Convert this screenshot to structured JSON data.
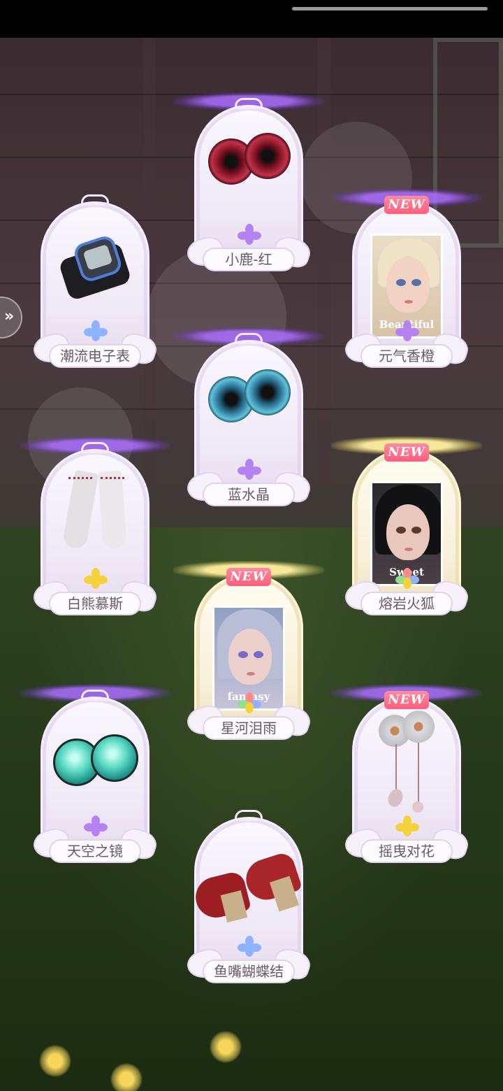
{
  "items": [
    {
      "name": "小鹿-红",
      "new": false,
      "gem": "purple",
      "glow": "purple",
      "kind": "eyes-red"
    },
    {
      "name": "潮流电子表",
      "new": false,
      "gem": "blue",
      "glow": "none",
      "kind": "watch"
    },
    {
      "name": "元气香橙",
      "new": true,
      "gem": "purple",
      "glow": "purple",
      "kind": "portrait",
      "portrait_text": "Beautiful"
    },
    {
      "name": "蓝水晶",
      "new": false,
      "gem": "purple",
      "glow": "purple",
      "kind": "eyes-blue"
    },
    {
      "name": "白熊慕斯",
      "new": false,
      "gem": "gold",
      "glow": "purple",
      "kind": "socks"
    },
    {
      "name": "熔岩火狐",
      "new": true,
      "gem": "rainbow",
      "glow": "gold",
      "kind": "portrait",
      "portrait_text": "Sweet"
    },
    {
      "name": "星河泪雨",
      "new": true,
      "gem": "rainbow",
      "glow": "gold",
      "kind": "portrait",
      "portrait_text": "fantasy"
    },
    {
      "name": "天空之镜",
      "new": false,
      "gem": "purple",
      "glow": "purple",
      "kind": "eyes-teal"
    },
    {
      "name": "摇曳对花",
      "new": true,
      "gem": "gold",
      "glow": "purple",
      "kind": "hairpin"
    },
    {
      "name": "鱼嘴蝴蝶结",
      "new": false,
      "gem": "blue",
      "glow": "none",
      "kind": "shoes"
    }
  ],
  "new_badge_text": "NEW",
  "colors": {
    "purple_glow": "#a86cff",
    "gold_glow": "#fff0a0",
    "badge": "#ff6a85"
  },
  "icons": {
    "side_button": "chevrons-right-icon"
  }
}
